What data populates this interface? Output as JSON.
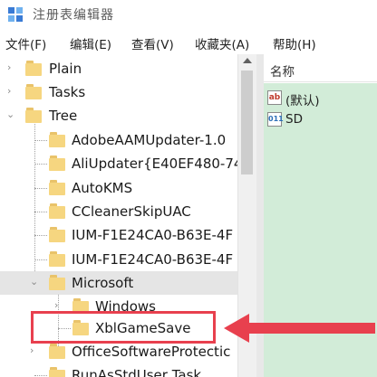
{
  "window": {
    "title": "注册表编辑器"
  },
  "menu": [
    {
      "label": "文件(F)"
    },
    {
      "label": "编辑(E)"
    },
    {
      "label": "查看(V)"
    },
    {
      "label": "收藏夹(A)"
    },
    {
      "label": "帮助(H)"
    }
  ],
  "tree": [
    {
      "label": "Plain",
      "expander": "›"
    },
    {
      "label": "Tasks",
      "expander": "›"
    },
    {
      "label": "Tree",
      "expander": "⌄"
    },
    {
      "label": "AdobeAAMUpdater-1.0"
    },
    {
      "label": "AliUpdater{E40EF480-74"
    },
    {
      "label": "AutoKMS"
    },
    {
      "label": "CCleanerSkipUAC"
    },
    {
      "label": "IUM-F1E24CA0-B63E-4F"
    },
    {
      "label": "IUM-F1E24CA0-B63E-4F"
    },
    {
      "label": "Microsoft",
      "expander": "⌄"
    },
    {
      "label": "Windows",
      "expander": "›"
    },
    {
      "label": "XblGameSave"
    },
    {
      "label": "OfficeSoftwareProtectic",
      "expander": "›"
    },
    {
      "label": "RunAsStdUser Task"
    }
  ],
  "right_pane": {
    "column_header": "名称",
    "values": [
      {
        "icon": "ab",
        "label": "(默认)"
      },
      {
        "icon": "011",
        "label": "SD"
      }
    ]
  },
  "colors": {
    "highlight": "#e8404e",
    "value_area": "#d2ecd8"
  }
}
